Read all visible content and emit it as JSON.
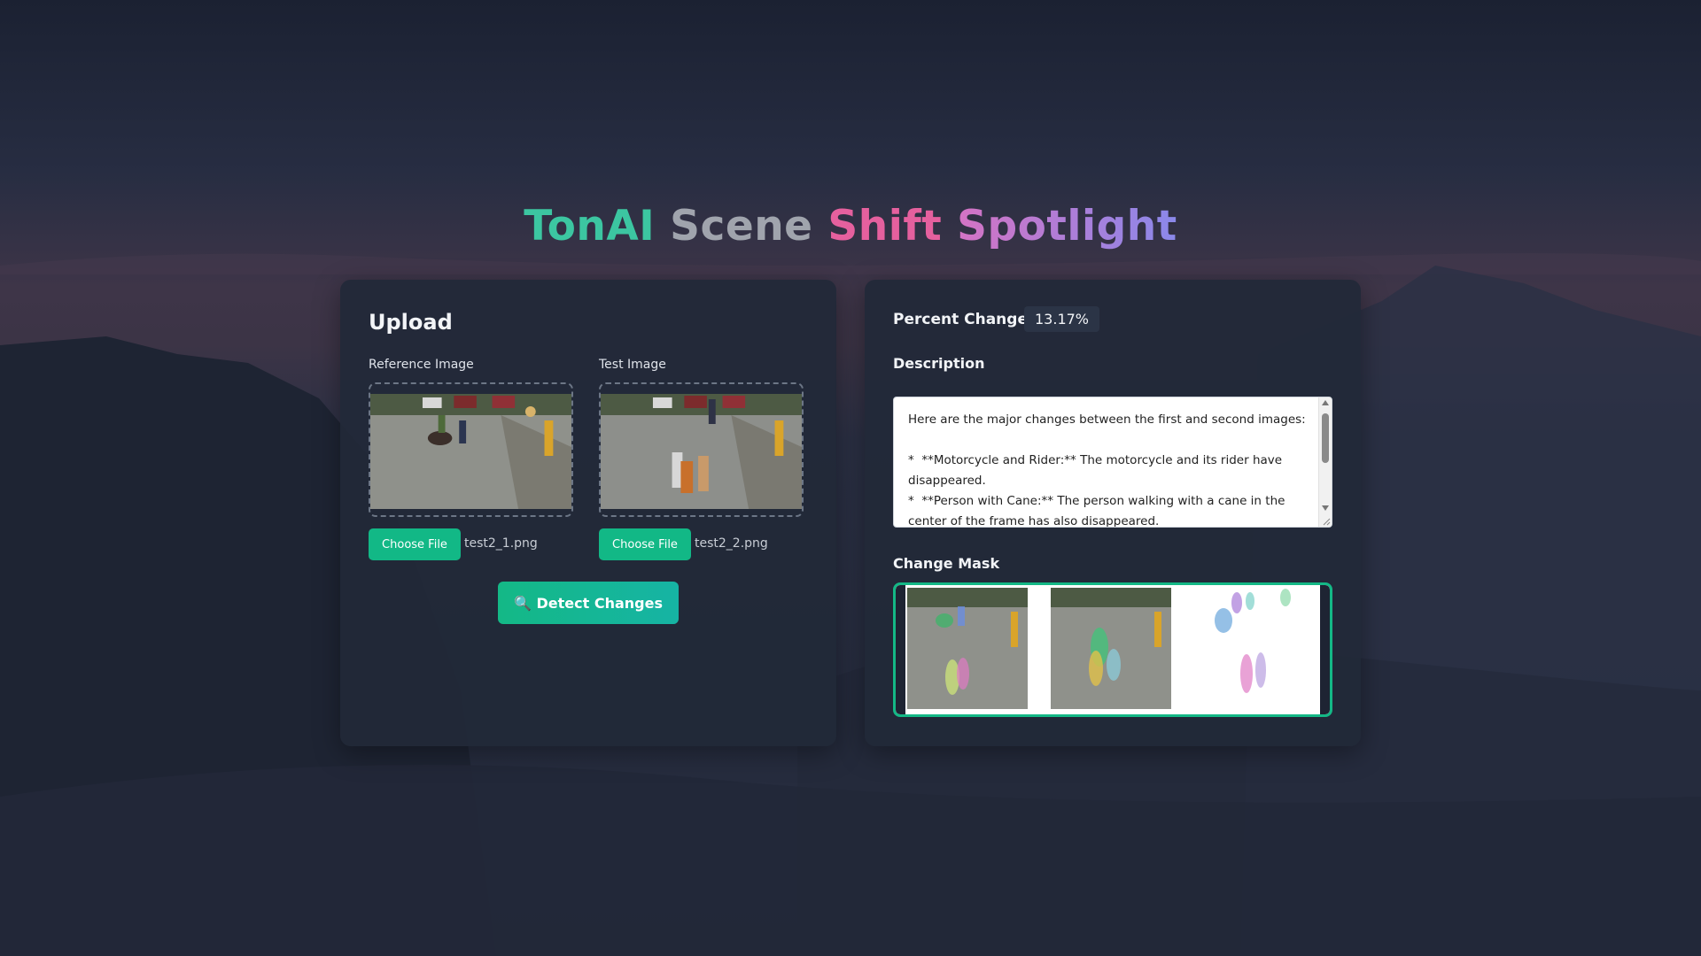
{
  "title": {
    "w1": "TonAI",
    "w2": "Scene",
    "w3": "Shift",
    "w4": "Spotlight"
  },
  "upload": {
    "heading": "Upload",
    "reference": {
      "label": "Reference Image",
      "button": "Choose File",
      "file": "test2_1.png"
    },
    "test": {
      "label": "Test Image",
      "button": "Choose File",
      "file": "test2_2.png"
    },
    "detect_button": "🔍 Detect Changes"
  },
  "results": {
    "percent_label": "Percent Change:",
    "percent_value": "13.17%",
    "description_label": "Description",
    "description_text": "Here are the major changes between the first and second images:\n\n*  **Motorcycle and Rider:** The motorcycle and its rider have disappeared.\n*  **Person with Cane:** The person walking with a cane in the center of the frame has also disappeared.",
    "mask_label": "Change Mask"
  },
  "colors": {
    "accent": "#14b886",
    "card": "#212938",
    "title_teal": "#3cc6a1",
    "title_pink": "#e5609e",
    "title_violet": "#8a88ea"
  }
}
